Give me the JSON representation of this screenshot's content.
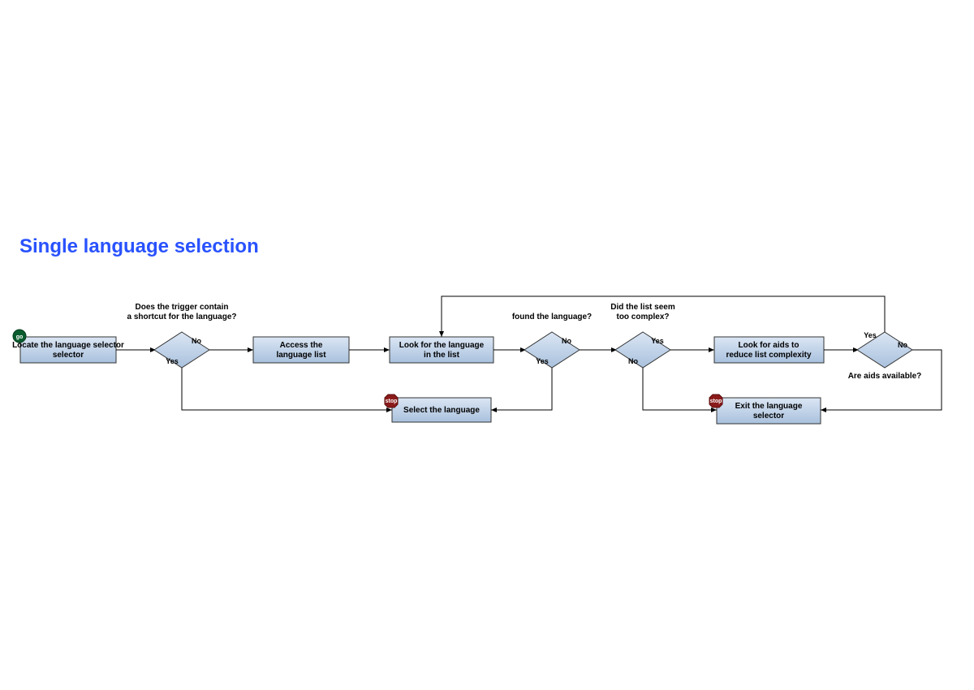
{
  "title": "Single language selection",
  "nodes": {
    "locate": "Locate the language selector",
    "triggerQ": "Does the trigger contain a shortcut for the language?",
    "access": "Access the language list",
    "look": "Look for the language in the list",
    "foundQ": "found the language?",
    "complexQ": "Did the list seem too complex?",
    "aids": "Look for aids to reduce list complexity",
    "aidsQ": "Are aids available?",
    "select": "Select the language",
    "exit": "Exit the language selector"
  },
  "labels": {
    "yes": "Yes",
    "no": "No",
    "go": "go",
    "stop": "stop"
  }
}
